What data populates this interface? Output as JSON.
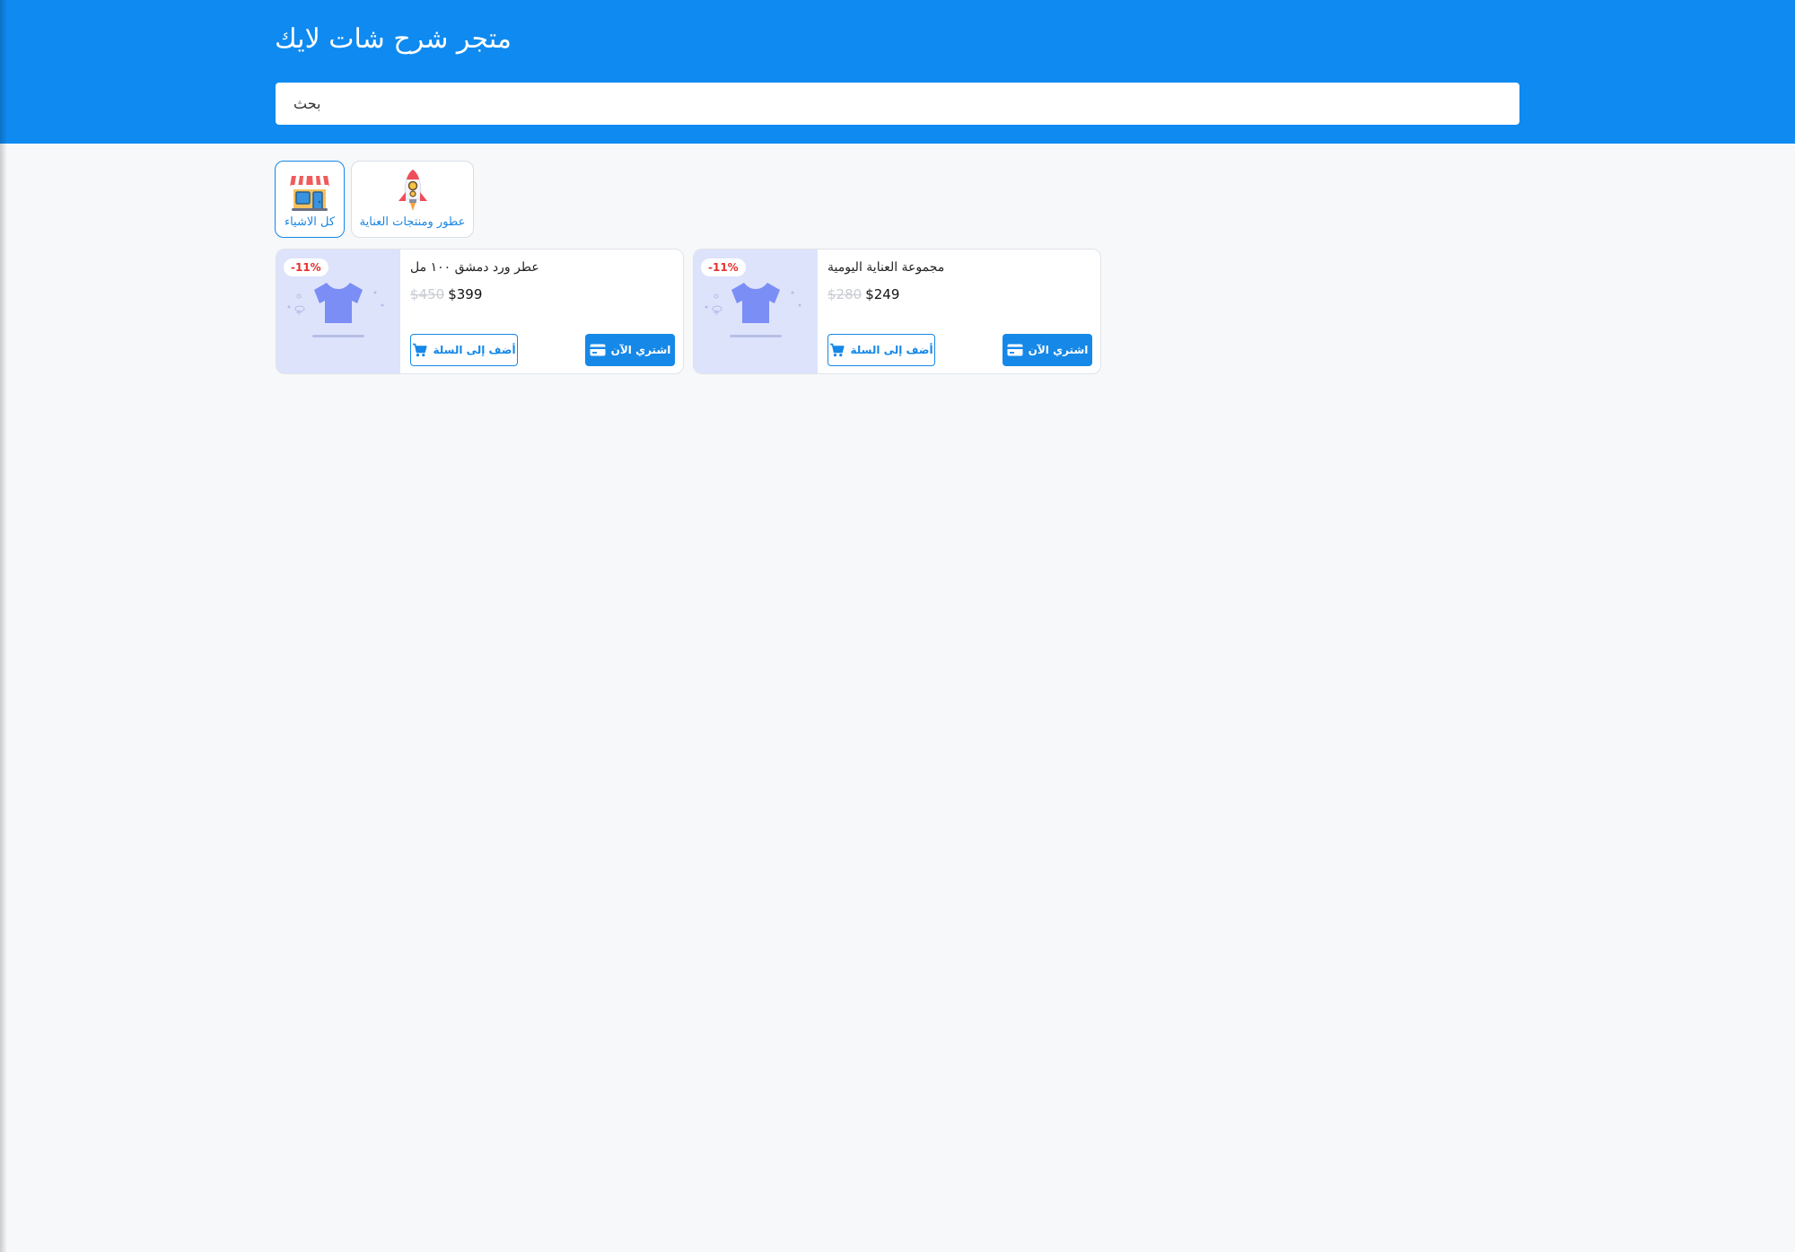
{
  "header": {
    "title": "متجر شرح شات لايك",
    "search_placeholder": "بحث"
  },
  "categories": [
    {
      "label": "كل الاشياء",
      "icon": "shop-icon",
      "active": true
    },
    {
      "label": "عطور ومنتجات العناية",
      "icon": "rocket-icon",
      "active": false
    }
  ],
  "products": [
    {
      "name": "عطر ورد دمشق ١٠٠ مل",
      "old_price": "$450",
      "new_price": "$399",
      "discount": "-11%",
      "add_to_cart_label": "أضف إلى السلة",
      "buy_now_label": "اشتري الآن"
    },
    {
      "name": "مجموعة العناية اليومية",
      "old_price": "$280",
      "new_price": "$249",
      "discount": "-11%",
      "add_to_cart_label": "أضف إلى السلة",
      "buy_now_label": "اشتري الآن"
    }
  ],
  "colors": {
    "brand": "#0f8af0",
    "discount": "#e63131",
    "image_bg": "#dde3fb"
  }
}
